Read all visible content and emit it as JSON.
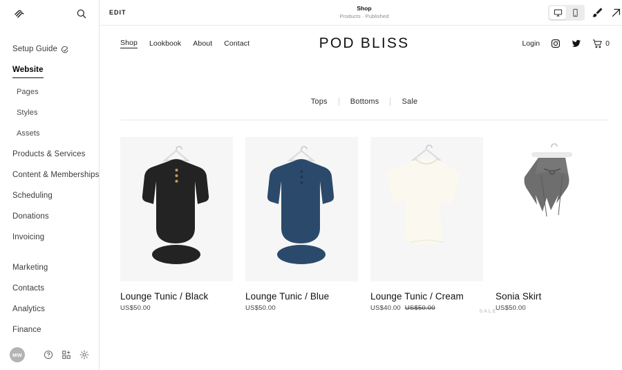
{
  "sidebar": {
    "logo_icon": "squarespace-logo",
    "search_icon": "search-icon",
    "items": [
      {
        "label": "Setup Guide",
        "level": "top",
        "active": false,
        "icon": "check-circle-icon"
      },
      {
        "label": "Website",
        "level": "top",
        "active": true
      },
      {
        "label": "Pages",
        "level": "sub",
        "active": false
      },
      {
        "label": "Styles",
        "level": "sub",
        "active": false
      },
      {
        "label": "Assets",
        "level": "sub",
        "active": false
      },
      {
        "label": "Products & Services",
        "level": "top",
        "active": false
      },
      {
        "label": "Content & Memberships",
        "level": "top",
        "active": false
      },
      {
        "label": "Scheduling",
        "level": "top",
        "active": false
      },
      {
        "label": "Donations",
        "level": "top",
        "active": false
      },
      {
        "label": "Invoicing",
        "level": "top",
        "active": false
      },
      {
        "label": "Marketing",
        "level": "top",
        "active": false,
        "gap_before": true
      },
      {
        "label": "Contacts",
        "level": "top",
        "active": false
      },
      {
        "label": "Analytics",
        "level": "top",
        "active": false
      },
      {
        "label": "Finance",
        "level": "top",
        "active": false
      }
    ],
    "footer": {
      "avatar_initials": "MW",
      "help_icon": "help-circle-icon",
      "add_block_icon": "add-block-icon",
      "settings_icon": "gear-icon"
    }
  },
  "editbar": {
    "edit_label": "EDIT",
    "page_title": "Shop",
    "page_subtitle": "Products · Published",
    "device_desktop_icon": "desktop-icon",
    "device_mobile_icon": "mobile-icon",
    "design_icon": "paintbrush-icon",
    "open_icon": "arrow-up-right-icon",
    "selected_device": "desktop"
  },
  "site": {
    "brand": "POD BLISS",
    "nav": [
      {
        "label": "Shop",
        "active": true
      },
      {
        "label": "Lookbook",
        "active": false
      },
      {
        "label": "About",
        "active": false
      },
      {
        "label": "Contact",
        "active": false
      }
    ],
    "actions": {
      "login_label": "Login",
      "instagram_icon": "instagram-icon",
      "twitter_icon": "twitter-icon",
      "cart_icon": "shopping-cart-icon",
      "cart_count": "0"
    },
    "categories": [
      {
        "label": "Tops"
      },
      {
        "label": "Bottoms"
      },
      {
        "label": "Sale"
      }
    ],
    "products": [
      {
        "title": "Lounge Tunic / Black",
        "price": "US$50.00",
        "old_price": "",
        "sale": false,
        "sale_label": "",
        "garment": "tunic-black",
        "bg": "#f6f6f6",
        "color": "#232323"
      },
      {
        "title": "Lounge Tunic / Blue",
        "price": "US$50.00",
        "old_price": "",
        "sale": false,
        "sale_label": "",
        "garment": "tunic-blue",
        "bg": "#f6f6f6",
        "color": "#2b4a6b"
      },
      {
        "title": "Lounge Tunic / Cream",
        "price": "US$40.00",
        "old_price": "US$50.00",
        "sale": true,
        "sale_label": "SALE",
        "garment": "tunic-cream",
        "bg": "#f6f6f6",
        "color": "#fbf8ef"
      },
      {
        "title": "Sonia Skirt",
        "price": "US$50.00",
        "old_price": "",
        "sale": false,
        "sale_label": "",
        "garment": "skirt-gray",
        "bg": "#ffffff",
        "color": "#6e6e6e"
      }
    ]
  },
  "colors": {
    "accent": "#111111",
    "muted": "#8a8a8a",
    "card_bg": "#f6f6f6",
    "border": "#e4e4e4"
  }
}
